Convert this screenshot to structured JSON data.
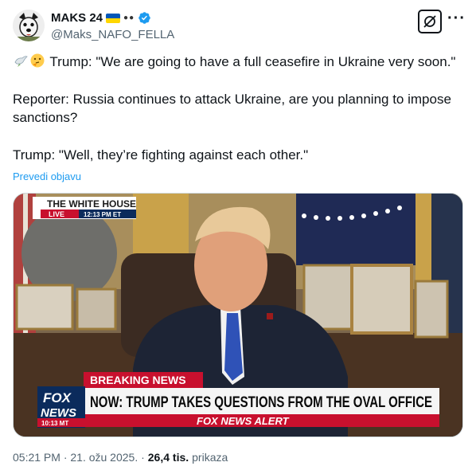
{
  "author": {
    "display_name": "MAKS 24",
    "handle": "@Maks_NAFO_FELLA",
    "avatar": "dog-avatar-icon",
    "flag": "ukraine-flag-icon",
    "badge": "verified-icon"
  },
  "actions": {
    "grok_icon": "grok-icon",
    "more_icon": "more-icon"
  },
  "tweet": {
    "line1": "Trump: \"We are going to have a full ceasefire in Ukraine very soon.\"",
    "line2": "Reporter: Russia continues to attack Ukraine, are you planning to impose sanctions?",
    "line3": "Trump: \"Well, they’re fighting against each other.\"",
    "translate": "Prevedi objavu"
  },
  "media": {
    "bug_top": "THE WHITE HOUSE",
    "bug_live": "LIVE",
    "bug_time": "12:13 PM ET",
    "breaking": "BREAKING NEWS",
    "headline": "NOW: TRUMP TAKES QUESTIONS FROM THE OVAL OFFICE",
    "alert": "FOX NEWS ALERT",
    "logo_fox": "FOX",
    "logo_news": "NEWS",
    "logo_time": "10:13 MT"
  },
  "footer": {
    "time": "05:21 PM · 21. ožu 2025. ·",
    "views_number": "26,4 tis.",
    "views_label": "prikaza"
  },
  "colors": {
    "link": "#1d9bf0",
    "verified": "#1d9bf0",
    "secondary_text": "#536471",
    "breaking_red": "#c8102e",
    "fox_blue": "#003366"
  }
}
